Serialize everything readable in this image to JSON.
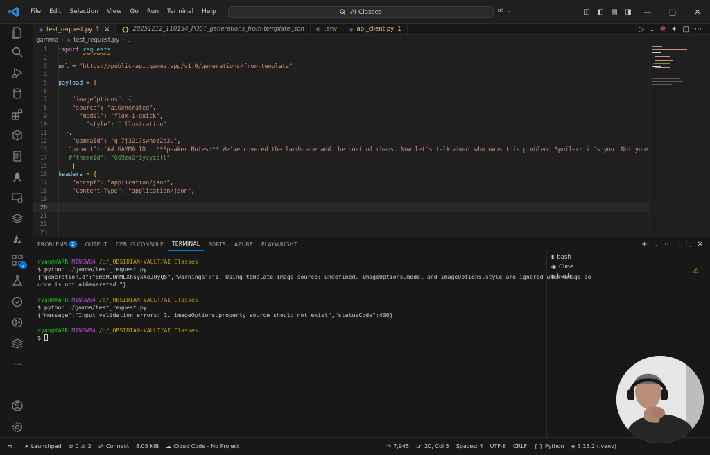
{
  "title_bar": {
    "menu": [
      "File",
      "Edit",
      "Selection",
      "View",
      "Go",
      "Run",
      "Terminal",
      "Help"
    ],
    "command_center": "AI Classes"
  },
  "tabs": [
    {
      "name": "test_request.py",
      "suffix": "1",
      "active": true,
      "color": "#e2c08d"
    },
    {
      "name": "20251212_110154_POST_generations_from-template.json",
      "suffix": "",
      "active": false
    },
    {
      "name": ".env",
      "suffix": "",
      "active": false
    },
    {
      "name": "api_client.py",
      "suffix": "1",
      "active": false
    }
  ],
  "breadcrumb": [
    "gamma",
    "test_request.py",
    "..."
  ],
  "editor": {
    "current_line": 20,
    "lines": [
      {
        "n": "1"
      },
      {
        "n": "2"
      },
      {
        "n": "3"
      },
      {
        "n": "4"
      },
      {
        "n": "5"
      },
      {
        "n": "6"
      },
      {
        "n": "7"
      },
      {
        "n": "8"
      },
      {
        "n": "9"
      },
      {
        "n": "10"
      },
      {
        "n": "11"
      },
      {
        "n": "12"
      },
      {
        "n": "13"
      },
      {
        "n": "14"
      },
      {
        "n": "15"
      },
      {
        "n": "16"
      },
      {
        "n": "17"
      },
      {
        "n": "18"
      },
      {
        "n": "19"
      },
      {
        "n": "20"
      },
      {
        "n": "21"
      },
      {
        "n": "22"
      },
      {
        "n": "23"
      }
    ],
    "code": {
      "l1_kw": "import",
      "l1_mod": "requests",
      "l3_var": "url",
      "l3_eq": " = ",
      "l3_url": "\"https://public-api.gamma.app/v1.0/generations/from-template\"",
      "l5_var": "payload",
      "l5_eq": " = ",
      "l7_key": "\"imageOptions\"",
      "l8_key": "\"source\"",
      "l8_val": "\"aiGenerated\"",
      "l9_key": "\"model\"",
      "l9_val": "\"flux-1-quick\"",
      "l10_key": "\"style\"",
      "l10_val": "\"illustration\"",
      "l12_key": "\"gammaId\"",
      "l12_val": "\"g_7j32i7swnoz2o3u\"",
      "l13_key": "\"prompt\"",
      "l13_val": "\"## GAMMA ID   **Speaker Notes:** We've covered the landscape and the cost of chaos. Now let's talk about who owns this problem. Spoiler: it's you. Not your CTO",
      "l14_comment": "#\"themeId\": \"669zo6f1yvyioll\"",
      "l16_var": "headers",
      "l16_eq": " = ",
      "l17_key": "\"accept\"",
      "l17_val": "\"application/json\"",
      "l18_key": "\"Content-Type\"",
      "l18_val": "\"application/json\""
    }
  },
  "panel": {
    "tabs": [
      "PROBLEMS",
      "OUTPUT",
      "DEBUG CONSOLE",
      "TERMINAL",
      "PORTS",
      "AZURE",
      "PLAYWRIGHT"
    ],
    "problems_count": "2",
    "active_tab": "TERMINAL",
    "terminal": {
      "user": "ryan@YARR",
      "shell": "MINGW64",
      "path": "/d/_OBSIDIAN-VAULT/AI Classes",
      "cmd1": "$ python ./gamma/test_request.py",
      "out1a": "{\"generationId\":\"BmaMUOnMLXhsyx4eJ0yQ5\",\"warnings\":\"1. Using template image source: undefined. imageOptions.model and imageOptions.style are ignored when image so",
      "out1b": "urce is not aiGenerated.\"}",
      "cmd2": "$ python ./gamma/test_request.py",
      "out2": "{\"message\":\"Input validation errors: 1. imageOptions.property source should not exist\",\"statusCode\":400}",
      "prompt": "$ "
    },
    "terminal_list": [
      "bash",
      "Cline",
      "bash"
    ]
  },
  "status_bar": {
    "launchpad": "Launchpad",
    "errors": "0",
    "warnings": "2",
    "connect": "Connect",
    "size": "8.05 KiB",
    "cloud": "Cloud Code - No Project",
    "chars": "7,945",
    "position": "Ln 20, Col 5",
    "spaces": "Spaces: 4",
    "encoding": "UTF-8",
    "eol": "CRLF",
    "language": "Python",
    "interpreter": "3.13.2 (.venv)"
  }
}
